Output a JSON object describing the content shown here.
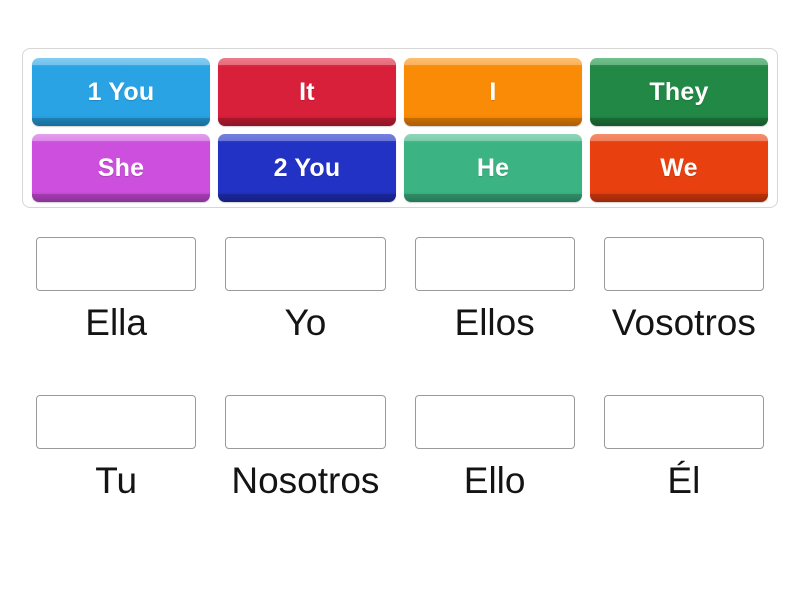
{
  "activity": {
    "type": "drag-and-drop-match",
    "tile_tray": {
      "rows": [
        [
          {
            "label": "1 You",
            "color": "#29a3e3",
            "top_edge": "#4fb8ec",
            "bottom_edge": "#1d84bd"
          },
          {
            "label": "It",
            "color": "#d8203a",
            "top_edge": "#e34459",
            "bottom_edge": "#ae172c"
          },
          {
            "label": "I",
            "color": "#f98b07",
            "top_edge": "#fba233",
            "bottom_edge": "#d27103"
          },
          {
            "label": "They",
            "color": "#218845",
            "top_edge": "#32a95c",
            "bottom_edge": "#196b36"
          }
        ],
        [
          {
            "label": "She",
            "color": "#cc4fdd",
            "top_edge": "#d973e6",
            "bottom_edge": "#a93bb8"
          },
          {
            "label": "2 You",
            "color": "#2232c4",
            "top_edge": "#3b4ad6",
            "bottom_edge": "#1a269b"
          },
          {
            "label": "He",
            "color": "#3cb382",
            "top_edge": "#5ec69a",
            "bottom_edge": "#2e9068"
          },
          {
            "label": "We",
            "color": "#e8400f",
            "top_edge": "#f35c2d",
            "bottom_edge": "#bc320b"
          }
        ]
      ]
    },
    "answers": {
      "rows": [
        [
          {
            "label": "Ella",
            "drop_value": ""
          },
          {
            "label": "Yo",
            "drop_value": ""
          },
          {
            "label": "Ellos",
            "drop_value": ""
          },
          {
            "label": "Vosotros",
            "drop_value": ""
          }
        ],
        [
          {
            "label": "Tu",
            "drop_value": ""
          },
          {
            "label": "Nosotros",
            "drop_value": ""
          },
          {
            "label": "Ello",
            "drop_value": ""
          },
          {
            "label": "Él",
            "drop_value": ""
          }
        ]
      ]
    }
  }
}
